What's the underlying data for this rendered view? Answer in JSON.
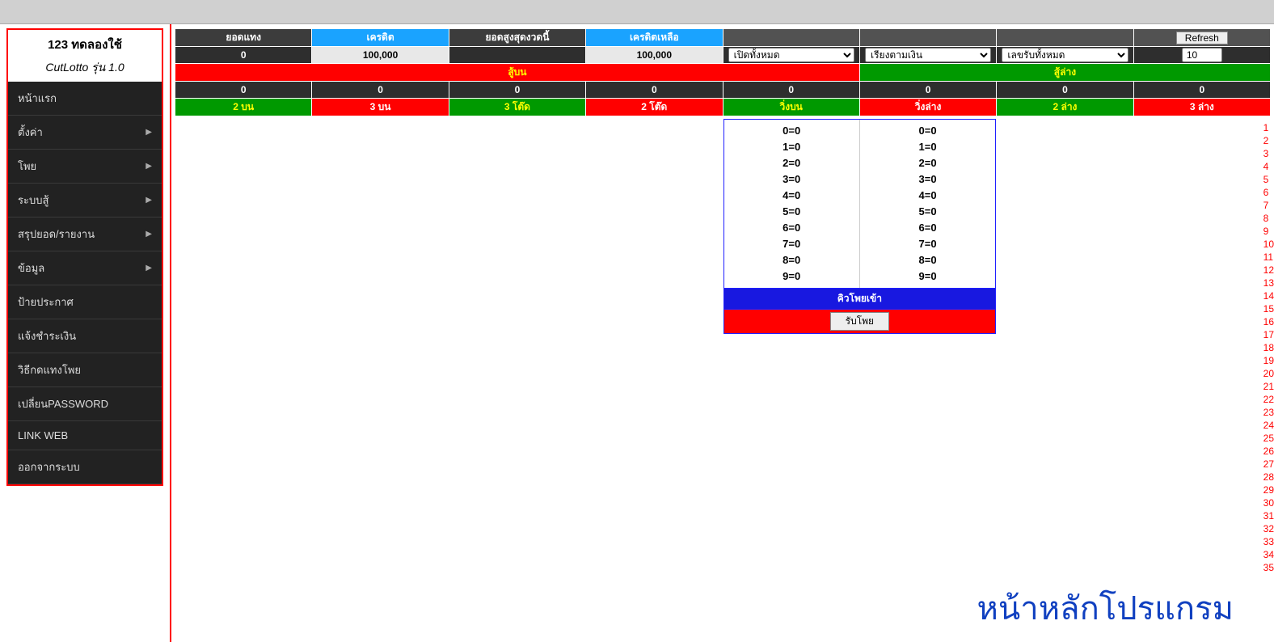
{
  "sidebar": {
    "title": "123 ทดลองใช้",
    "subtitle": "CutLotto รุ่น 1.0",
    "items": [
      {
        "label": "หน้าแรก",
        "sub": false
      },
      {
        "label": "ตั้งค่า",
        "sub": true
      },
      {
        "label": "โพย",
        "sub": true
      },
      {
        "label": "ระบบสู้",
        "sub": true
      },
      {
        "label": "สรุปยอด/รายงาน",
        "sub": true
      },
      {
        "label": "ข้อมูล",
        "sub": true
      },
      {
        "label": "ป้ายประกาศ",
        "sub": false
      },
      {
        "label": "แจ้งชำระเงิน",
        "sub": false
      },
      {
        "label": "วิธีกดแทงโพย",
        "sub": false
      },
      {
        "label": "เปลี่ยนPASSWORD",
        "sub": false
      },
      {
        "label": "LINK WEB",
        "sub": false
      },
      {
        "label": "ออกจากระบบ",
        "sub": false
      }
    ]
  },
  "header": {
    "cols": [
      "ยอดแทง",
      "เครดิต",
      "ยอดสูงสุดงวดนี้",
      "เครดิตเหลือ"
    ],
    "refresh": "Refresh",
    "vals": [
      "0",
      "100,000",
      "",
      "100,000"
    ],
    "select1": "เปิดทั้งหมด",
    "select2": "เรียงตามเงิน",
    "select3": "เลขรับทั้งหมด",
    "input1": "10"
  },
  "bands": {
    "red": "สู้บน",
    "green": "สู้ล่าง"
  },
  "zeros": [
    "0",
    "0",
    "0",
    "0",
    "0",
    "0",
    "0",
    "0"
  ],
  "types": [
    {
      "label": "2 บน",
      "cls": "type-green"
    },
    {
      "label": "3 บน",
      "cls": "type-red"
    },
    {
      "label": "3 โต๊ด",
      "cls": "type-green"
    },
    {
      "label": "2 โต๊ด",
      "cls": "type-red"
    },
    {
      "label": "วิ่งบน",
      "cls": "type-green"
    },
    {
      "label": "วิ่งล่าง",
      "cls": "type-red"
    },
    {
      "label": "2 ล่าง",
      "cls": "type-green"
    },
    {
      "label": "3 ล่าง",
      "cls": "type-red"
    }
  ],
  "poy": {
    "colA": [
      "0=0",
      "1=0",
      "2=0",
      "3=0",
      "4=0",
      "5=0",
      "6=0",
      "7=0",
      "8=0",
      "9=0"
    ],
    "colB": [
      "0=0",
      "1=0",
      "2=0",
      "3=0",
      "4=0",
      "5=0",
      "6=0",
      "7=0",
      "8=0",
      "9=0"
    ],
    "queue": "คิวโพยเข้า",
    "receive": "รับโพย"
  },
  "sidenums": [
    "1",
    "2",
    "3",
    "4",
    "5",
    "6",
    "7",
    "8",
    "9",
    "10",
    "11",
    "12",
    "13",
    "14",
    "15",
    "16",
    "17",
    "18",
    "19",
    "20",
    "21",
    "22",
    "23",
    "24",
    "25",
    "26",
    "27",
    "28",
    "29",
    "30",
    "31",
    "32",
    "33",
    "34",
    "35"
  ],
  "bigtext": "หน้าหลักโปรแกรม"
}
